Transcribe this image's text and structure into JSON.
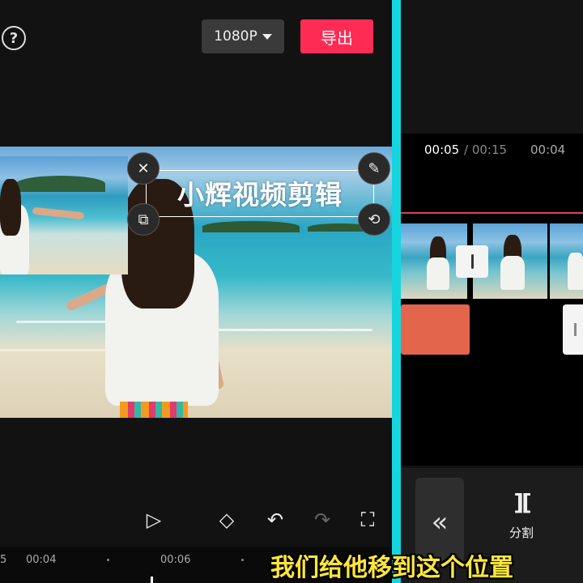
{
  "header": {
    "help_icon": "help-circle-icon",
    "resolution_label": "1080P",
    "export_label": "导出"
  },
  "preview": {
    "overlay_text": "小辉视频剪辑",
    "handles": {
      "delete_icon": "close-icon",
      "edit_icon": "pencil-icon",
      "copy_icon": "copy-icon",
      "rotate_icon": "rotate-icon"
    }
  },
  "toolbar": {
    "play_icon": "play-icon",
    "keyframe_icon": "add-keyframe-icon",
    "undo_icon": "undo-icon",
    "redo_icon": "redo-icon",
    "fullscreen_icon": "fullscreen-icon"
  },
  "timeline_left": {
    "edge_label": "5",
    "stamps": [
      "00:04",
      "00:06"
    ]
  },
  "right_panel": {
    "current_time": "00:05",
    "total_time": "/ 00:15",
    "marker_time": "00:04",
    "back_icon": "double-chevron-left-icon",
    "split_label": "分割"
  },
  "subtitle": "我们给他移到这个位置",
  "colors": {
    "export": "#fe2c55",
    "divider": "#15d6df",
    "audio_track": "#e2654c",
    "subtitle": "#ffe63a"
  }
}
